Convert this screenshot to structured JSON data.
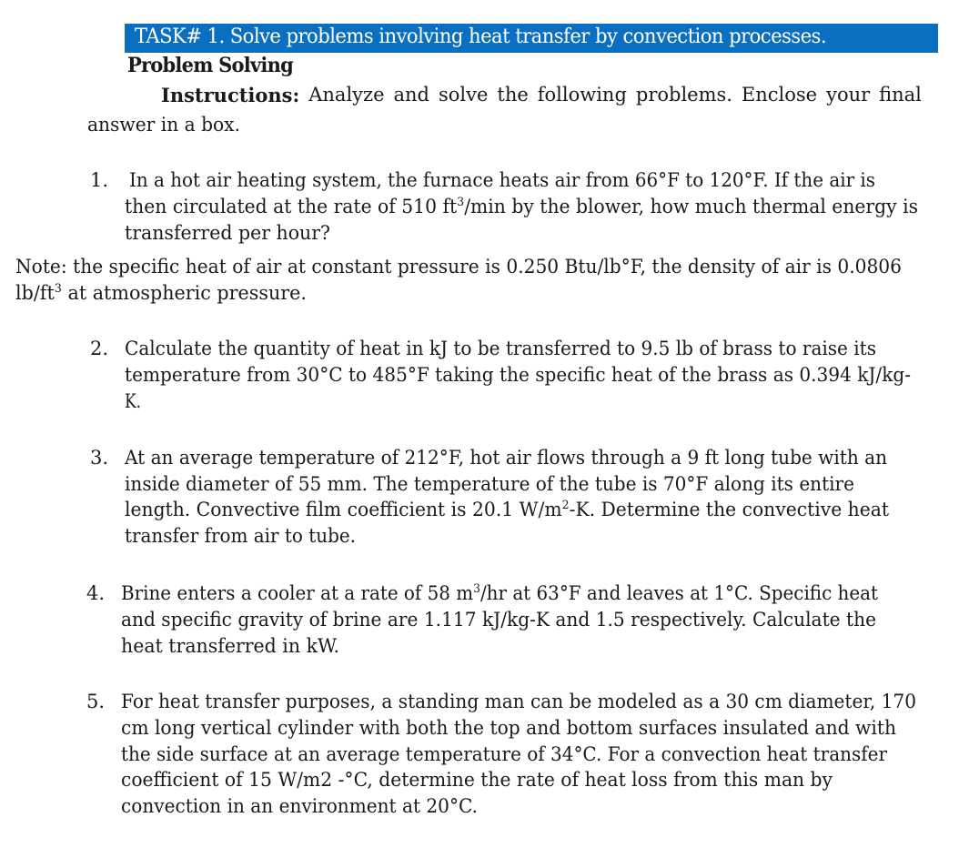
{
  "header": {
    "task_title": "TASK# 1. Solve problems involving heat transfer by convection processes.",
    "band_color": "#0b6fc1"
  },
  "subheading": "Problem Solving",
  "instructions": {
    "label": "Instructions:",
    "words": [
      "Analyze",
      "and",
      "solve",
      "the",
      "following",
      "problems.",
      "Enclose",
      "your",
      "final"
    ],
    "continuation": "answer in a box."
  },
  "problems": [
    {
      "number": "1.",
      "lines": [
        "In a hot air heating system, the furnace heats air from 66°F to 120°F. If the air is",
        [
          "then circulated at the rate of 510 ft",
          "3",
          "/min by the blower, how much thermal energy is"
        ],
        "transferred per hour?"
      ]
    },
    {
      "number": "2.",
      "lines": [
        "Calculate the quantity of heat in kJ to be transferred to 9.5 lb of brass to raise its",
        "temperature from 30°C to 485°F taking the specific heat of the brass as 0.394 kJ/kg-",
        "K."
      ]
    },
    {
      "number": "3.",
      "lines": [
        "At an average temperature of 212°F, hot air flows through a 9 ft long tube with an",
        "inside diameter of 55 mm. The temperature of the tube is 70°F along its entire",
        [
          "length. Convective film coefficient is 20.1 W/m",
          "2",
          "-K. Determine the convective heat"
        ],
        "transfer from air to tube."
      ]
    },
    {
      "number": "4.",
      "lines": [
        [
          "Brine enters a cooler at a rate of 58 m",
          "3",
          "/hr at 63°F and leaves at 1°C. Specific heat"
        ],
        "and specific gravity of brine are 1.117 kJ/kg-K and 1.5 respectively. Calculate the",
        "heat transferred in kW."
      ]
    },
    {
      "number": "5.",
      "lines": [
        "For heat transfer purposes, a standing man can be modeled as a 30 cm diameter, 170",
        "cm long vertical cylinder with both the top and bottom surfaces insulated and with",
        "the side surface at an average temperature of 34°C. For a convection heat transfer",
        "coefficient of 15 W/m2 -°C, determine the rate of heat loss from this man by",
        "convection in an environment at 20°C."
      ]
    }
  ],
  "note": {
    "lines": [
      "Note: the specific heat of air at constant pressure is 0.250 Btu/lb°F, the density of air is 0.0806",
      [
        "lb/ft",
        "3",
        " at atmospheric pressure."
      ]
    ]
  }
}
